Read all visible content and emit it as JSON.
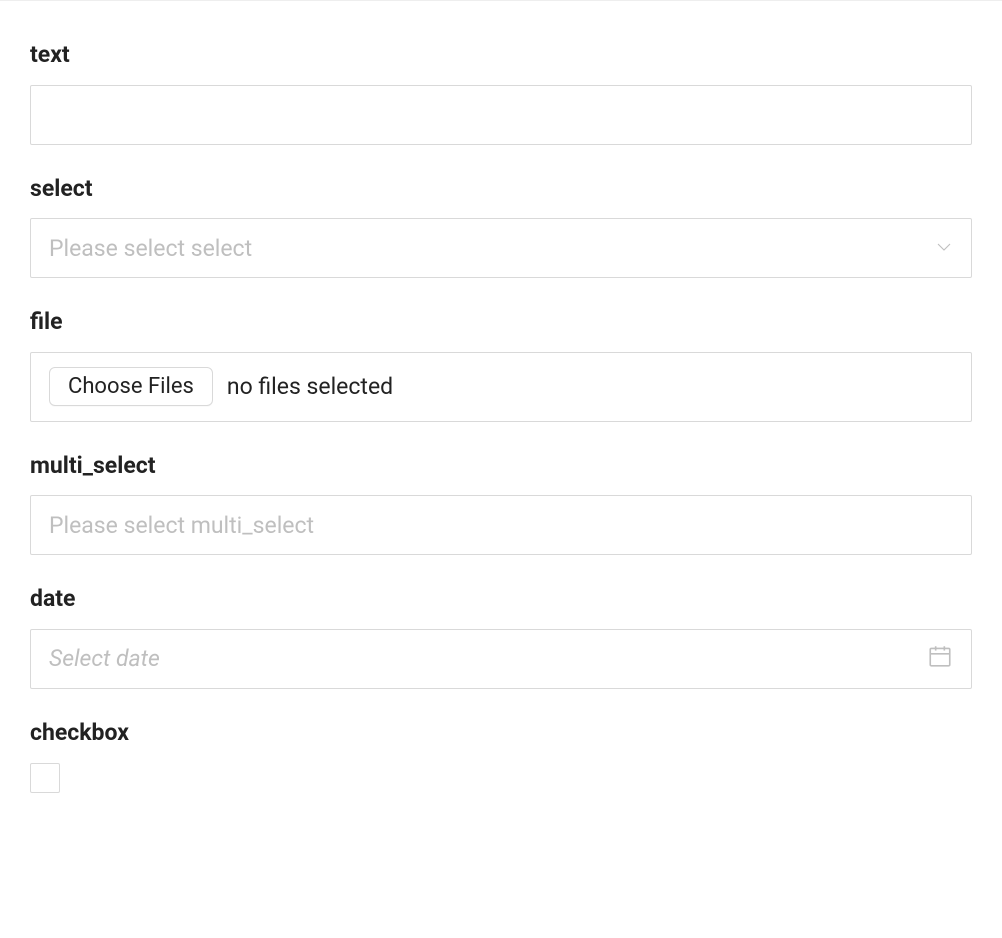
{
  "fields": {
    "text": {
      "label": "text",
      "value": ""
    },
    "select": {
      "label": "select",
      "placeholder": "Please select select"
    },
    "file": {
      "label": "file",
      "button": "Choose Files",
      "status": "no files selected"
    },
    "multi_select": {
      "label": "multi_select",
      "placeholder": "Please select multi_select"
    },
    "date": {
      "label": "date",
      "placeholder": "Select date"
    },
    "checkbox": {
      "label": "checkbox",
      "checked": false
    }
  }
}
